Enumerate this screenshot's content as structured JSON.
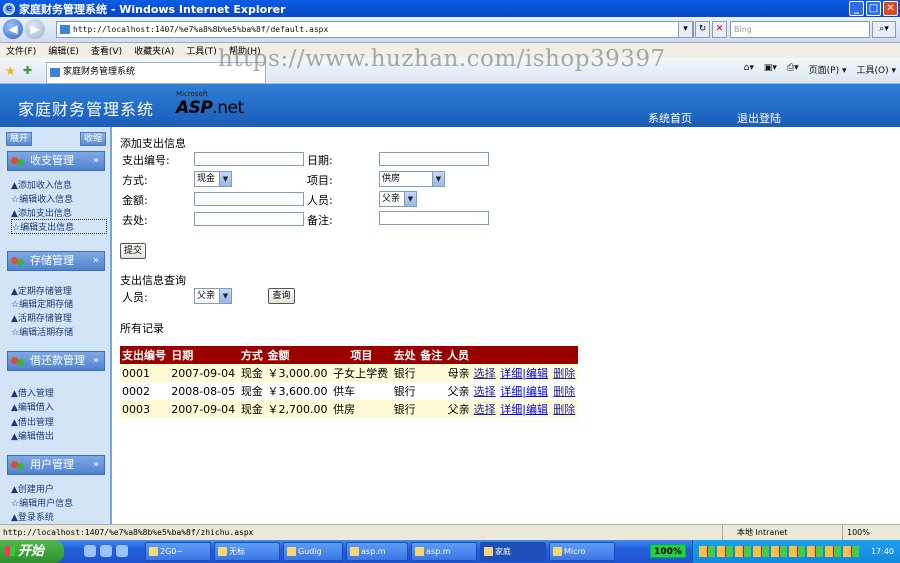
{
  "window": {
    "title": "家庭财务管理系统 - Windows Internet Explorer"
  },
  "browser": {
    "address": "http://localhost:1407/%e7%a8%8b%e5%ba%8f/default.aspx",
    "search_placeholder": "Bing",
    "menu": [
      "文件(F)",
      "编辑(E)",
      "查看(V)",
      "收藏夹(A)",
      "工具(T)",
      "帮助(H)"
    ],
    "tab_title": "家庭财务管理系统",
    "watermark": "https://www.huzhan.com/ishop39397",
    "commands": [
      "页面(P) ▾",
      "工具(O) ▾"
    ],
    "status_url": "http://localhost:1407/%e7%a8%8b%e5%ba%8f/zhichu.aspx",
    "status_zone": "本地 Intranet",
    "status_zoom": "100%"
  },
  "banner": {
    "title": "家庭财务管理系统",
    "logo_small": "Microsoft",
    "logo_main": "ASP",
    "logo_net": ".net",
    "nav": [
      "系统首页",
      "退出登陆"
    ]
  },
  "sidebar": {
    "expand": "展开",
    "collapse": "收缩",
    "groups": [
      {
        "title": "收支管理",
        "items": [
          "▲添加收入信息",
          "☆编辑收入信息",
          "▲添加支出信息",
          "☆编辑支出信息"
        ]
      },
      {
        "title": "存储管理",
        "items": [
          "▲定期存储管理",
          "☆编辑定期存储",
          "▲活期存储管理",
          "☆编辑活期存储"
        ]
      },
      {
        "title": "借还款管理",
        "items": [
          "▲借入管理",
          "▲编辑借入",
          "▲借出管理",
          "▲编辑借出"
        ]
      },
      {
        "title": "用户管理",
        "items": [
          "▲创建用户",
          "☆编辑用户信息",
          "▲登录系统"
        ]
      }
    ]
  },
  "form": {
    "heading": "添加支出信息",
    "id_label": "支出编号:",
    "date_label": "日期:",
    "method_label": "方式:",
    "method_value": "现金",
    "item_label": "项目:",
    "item_value": "供房",
    "amount_label": "金额:",
    "person_label": "人员:",
    "person_value": "父亲",
    "dest_label": "去处:",
    "note_label": "备注:",
    "submit": "提交"
  },
  "query": {
    "heading": "支出信息查询",
    "person_label": "人员:",
    "person_value": "父亲",
    "button": "查询"
  },
  "records": {
    "heading": "所有记录",
    "columns": [
      "支出编号",
      "日期",
      "方式",
      "金额",
      "项目",
      "去处",
      "备注",
      "人员"
    ],
    "rows": [
      {
        "id": "0001",
        "date": "2007-09-04",
        "method": "现金",
        "amount": "￥3,000.00",
        "item": "子女上学费",
        "dest": "银行",
        "note": "",
        "person": "母亲"
      },
      {
        "id": "0002",
        "date": "2008-08-05",
        "method": "现金",
        "amount": "￥3,600.00",
        "item": "供车",
        "dest": "银行",
        "note": "",
        "person": "父亲"
      },
      {
        "id": "0003",
        "date": "2007-09-04",
        "method": "现金",
        "amount": "￥2,700.00",
        "item": "供房",
        "dest": "银行",
        "note": "",
        "person": "父亲"
      }
    ],
    "actions": [
      "选择",
      "详细|编辑",
      "删除"
    ]
  },
  "taskbar": {
    "start": "开始",
    "tasks": [
      "2G0~",
      "无标",
      "Gudig",
      "asp.m",
      "asp.m",
      "家庭",
      "Micro"
    ],
    "battery": "100%",
    "clock": "17:40"
  }
}
